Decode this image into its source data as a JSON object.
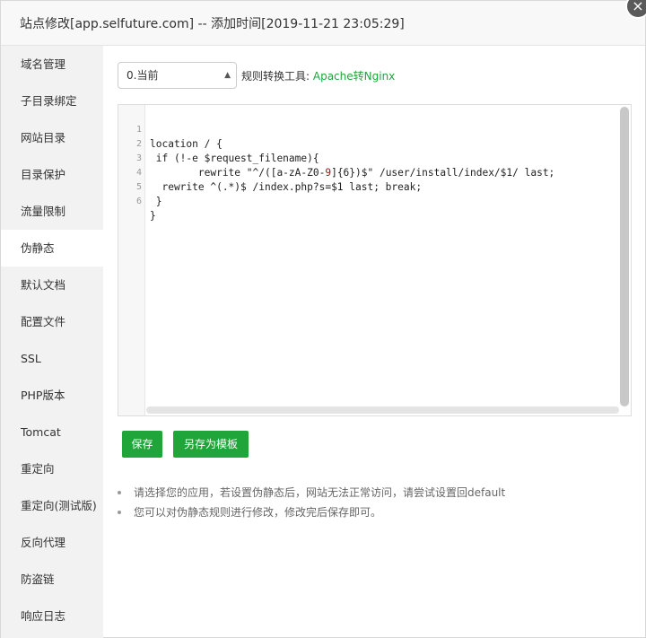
{
  "dialog": {
    "title": "站点修改[app.selfuture.com] -- 添加时间[2019-11-21 23:05:29]",
    "close_glyph": "×"
  },
  "sidebar": {
    "items": [
      {
        "label": "域名管理"
      },
      {
        "label": "子目录绑定"
      },
      {
        "label": "网站目录"
      },
      {
        "label": "目录保护"
      },
      {
        "label": "流量限制"
      },
      {
        "label": "伪静态",
        "active": true
      },
      {
        "label": "默认文档"
      },
      {
        "label": "配置文件"
      },
      {
        "label": "SSL"
      },
      {
        "label": "PHP版本"
      },
      {
        "label": "Tomcat"
      },
      {
        "label": "重定向"
      },
      {
        "label": "重定向(测试版)"
      },
      {
        "label": "反向代理"
      },
      {
        "label": "防盗链"
      },
      {
        "label": "响应日志"
      }
    ]
  },
  "rewrite": {
    "select_value": "0.当前",
    "tool_label": "规则转换工具:",
    "tool_link": "Apache转Nginx"
  },
  "editor": {
    "lines": [
      {
        "n": "1",
        "text": "location / {"
      },
      {
        "n": "2",
        "text": " if (!-e $request_filename){"
      },
      {
        "n": "3",
        "pre": "        rewrite \"^/([a-zA-Z0-",
        "hl": "9",
        "post": "]{6})$\" /user/install/index/$1/ last;"
      },
      {
        "n": "4",
        "text": "  rewrite ^(.*)$ /index.php?s=$1 last; break;"
      },
      {
        "n": "5",
        "text": " }"
      },
      {
        "n": "6",
        "text": "}"
      }
    ]
  },
  "buttons": {
    "save": "保存",
    "save_as_template": "另存为模板"
  },
  "tips": [
    "请选择您的应用，若设置伪静态后，网站无法正常访问，请尝试设置回default",
    "您可以对伪静态规则进行修改，修改完后保存即可。"
  ],
  "colors": {
    "accent": "#20a53a",
    "sidebar_bg": "#f2f2f2"
  }
}
